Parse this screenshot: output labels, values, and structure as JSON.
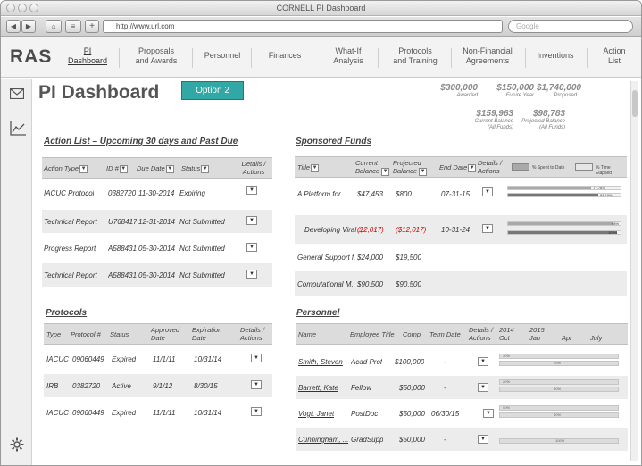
{
  "window": {
    "title": "CORNELL PI Dashboard"
  },
  "toolbar": {
    "back": "◀",
    "forward": "▶",
    "home": "⌂",
    "reader": "≡",
    "add": "+",
    "url": "http://www.url.com",
    "search_placeholder": "Google"
  },
  "nav": {
    "logo": "RAS",
    "items": [
      {
        "label": "PI\nDashboard",
        "active": true
      },
      {
        "label": "Proposals\nand Awards"
      },
      {
        "label": "Personnel"
      },
      {
        "label": "Finances"
      },
      {
        "label": "What-If\nAnalysis"
      },
      {
        "label": "Protocols\nand Training"
      },
      {
        "label": "Non-Financial\nAgreements"
      },
      {
        "label": "Inventions"
      },
      {
        "label": "Action\nList"
      }
    ]
  },
  "page": {
    "title": "PI Dashboard",
    "option_button": "Option 2",
    "stats": [
      {
        "value": "$300,000",
        "label": "Awarded"
      },
      {
        "value": "$150,000",
        "label": "Future Year"
      },
      {
        "value": "$1,740,000",
        "label": "Proposed..."
      },
      {
        "value": "$159,963",
        "label": "Current Balance\n(All Funds)"
      },
      {
        "value": "$98,783",
        "label": "Projected Balance\n(All Funds)"
      }
    ]
  },
  "action_list": {
    "title": "Action List – Upcoming 30 days and Past Due",
    "headers": [
      "Action Type",
      "ID #",
      "Due Date",
      "Status",
      "Details /\nActions"
    ],
    "rows": [
      [
        "IACUC Protocol",
        "0382720",
        "11-30-2014",
        "Expiring"
      ],
      [
        "Technical Report",
        "U768417",
        "12-31-2014",
        "Not Submitted"
      ],
      [
        "Progress Report",
        "A588431",
        "05-30-2014",
        "Not Submitted"
      ],
      [
        "Technical Report",
        "A588431",
        "05-30-2014",
        "Not Submitted"
      ]
    ]
  },
  "sponsored_funds": {
    "title": "Sponsored Funds",
    "headers": [
      "Title",
      "Current\nBalance",
      "Projected\nBalance",
      "End Date",
      "Details /\nActions"
    ],
    "legend": [
      "% Spent to Date",
      "% Time Elapsed"
    ],
    "legend_colors": [
      "#a9a9a9",
      "#e6e6e6"
    ],
    "rows": [
      {
        "title": "A Platform for ...",
        "current": "$47,453",
        "projected": "$800",
        "end": "07-31-15",
        "spent": 77.78,
        "elapsed": 84.18,
        "spent_label": "77.78%",
        "elapsed_label": "84.18%"
      },
      {
        "title": "Developing Viral ...",
        "current": "($2,017)",
        "projected": "($12,017)",
        "end": "10-31-24",
        "spent": 98,
        "elapsed": 102,
        "spent_label": "98%",
        "elapsed_label": "102%",
        "negative": true
      },
      {
        "title": "General Support f...",
        "current": "$24,000",
        "projected": "$19,500",
        "end": ""
      },
      {
        "title": "Computational M...",
        "current": "$90,500",
        "projected": "$90,500",
        "end": ""
      }
    ]
  },
  "protocols": {
    "title": "Protocols",
    "headers": [
      "Type",
      "Protocol #",
      "Status",
      "Approved\nDate",
      "Expiration\nDate",
      "Details /\nActions"
    ],
    "rows": [
      [
        "IACUC",
        "09060449",
        "Expired",
        "11/1/11",
        "10/31/14"
      ],
      [
        "IRB",
        "0382720",
        "Active",
        "9/1/12",
        "8/30/15"
      ],
      [
        "IACUC",
        "09060449",
        "Expired",
        "11/1/11",
        "10/31/14"
      ]
    ]
  },
  "personnel": {
    "title": "Personnel",
    "headers": [
      "Name",
      "Employee Title",
      "Comp",
      "Term Date",
      "Details /\nActions"
    ],
    "timeline": [
      "2014\nOct",
      "2015\nJan",
      "Apr",
      "July"
    ],
    "rows": [
      {
        "name": "Smith, Steven",
        "title": "Acad Prof",
        "comp": "$100,000",
        "term": "-",
        "bars": [
          {
            "p": "30%"
          },
          {
            "p": "20%"
          }
        ]
      },
      {
        "name": "Barrett, Kate",
        "title": "Fellow",
        "comp": "$50,000",
        "term": "-",
        "bars": [
          {
            "p": "20%"
          },
          {
            "p": "30%"
          }
        ]
      },
      {
        "name": "Vogt, Janet",
        "title": "PostDoc",
        "comp": "$50,000",
        "term": "06/30/15",
        "bars": [
          {
            "p": "50%"
          },
          {
            "p": "30%"
          }
        ]
      },
      {
        "name": "Cunningham, ...",
        "title": "GradSupp",
        "comp": "$50,000",
        "term": "-",
        "bars": [
          {
            "p": "100%"
          }
        ]
      }
    ]
  }
}
